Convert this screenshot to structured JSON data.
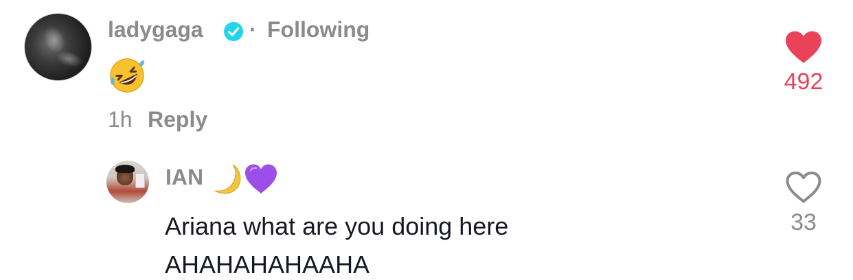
{
  "comment": {
    "username": "ladygaga",
    "separator": "·",
    "follow_status": "Following",
    "body_emoji": "rolling-on-the-floor-laughing-emoji",
    "time": "1h",
    "reply_label": "Reply",
    "like_count": "492",
    "liked": true,
    "like_color": "#ea4359",
    "verified_color": "#20d5ec"
  },
  "reply": {
    "username": "IAN",
    "name_emojis": [
      "crescent-moon-emoji",
      "purple-heart-emoji"
    ],
    "text": "Ariana what are you doing here\nAHAHAHAHAAHA",
    "like_count": "33",
    "liked": false
  },
  "colors": {
    "secondary_text": "#8a8a8f",
    "primary_text": "#161823",
    "heart_outline": "#8a8a8f",
    "moon": "#f5c542",
    "purple_heart": "#9b4fe8"
  }
}
